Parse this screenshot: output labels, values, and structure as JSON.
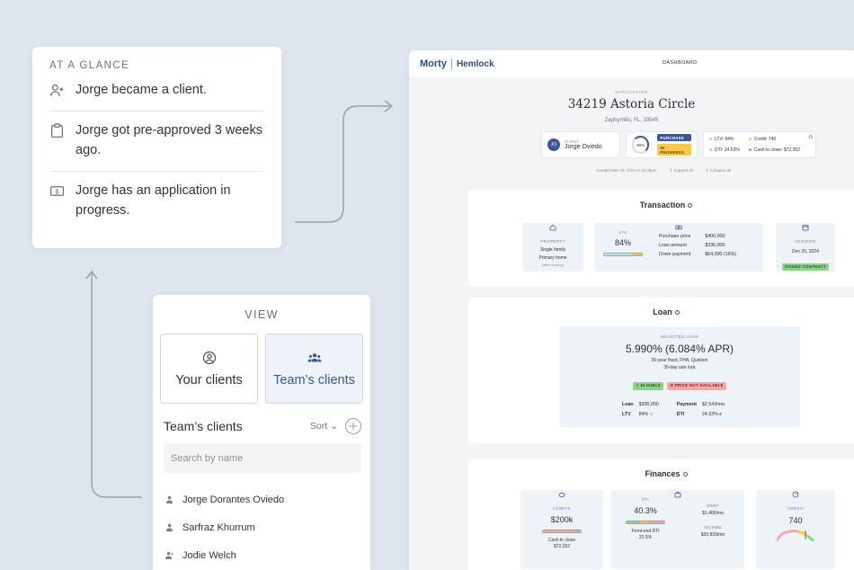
{
  "glance": {
    "heading": "AT A GLANCE",
    "items": [
      {
        "icon": "person-add-icon",
        "text": "Jorge became a client."
      },
      {
        "icon": "clipboard-icon",
        "text": "Jorge got pre-approved 3 weeks ago."
      },
      {
        "icon": "dollar-doc-icon",
        "text": "Jorge has an application in progress."
      }
    ]
  },
  "view": {
    "heading": "VIEW",
    "your_clients": "Your clients",
    "teams_clients": "Team’s clients",
    "list_title": "Team’s clients",
    "sort": "Sort",
    "search_placeholder": "Search by name",
    "clients": [
      "Jorge Dorantes Oviedo",
      "Sarfraz Khurrum",
      "Jodie Welch"
    ]
  },
  "dashboard": {
    "brand": "Morty",
    "partner": "Hemlock",
    "nav": "DASHBOARD",
    "application_label": "APPLICATION",
    "address": "34219 Astoria Circle",
    "city": "Zephyrhills, FL, 33545",
    "client_label": "CLIENT",
    "client_initials": "JO",
    "client_name": "Jorge Oviedo",
    "progress": "90%",
    "progress_value": 0.9,
    "badge_purchase": "PURCHASE",
    "badge_status": "IN PROGRESS",
    "ltv": "LTV: 84%",
    "credit": "Credit: 740",
    "dti": "DTI: 24.53%",
    "cash": "Cash to close: $72,352",
    "created": "Created Mar 18, 2024 at 12:39pm",
    "expand": "Expand all",
    "collapse": "Collapse all",
    "colors": {
      "brand": "#2c4b8a",
      "green": "#8fd08d",
      "yellow": "#f6c94a",
      "red": "#f8a7a7"
    }
  },
  "transaction": {
    "title": "Transaction",
    "property_label": "PROPERTY",
    "property_type": "Single family",
    "property_use": "Primary home",
    "property_note": "(after closing)",
    "ltv_label": "LTV",
    "ltv_value": "84%",
    "purchase_label": "Purchase price",
    "purchase_value": "$400,000",
    "loan_label": "Loan amount",
    "loan_value": "$336,000",
    "down_label": "Down payment",
    "down_value": "$64,000 (16%)",
    "closing_label": "CLOSING",
    "closing_date": "Dec 20, 2024",
    "closing_badge": "SIGNED CONTRACT"
  },
  "loan": {
    "title": "Loan",
    "selected_label": "SELECTED LOAN",
    "rate": "5.990% (6.084% APR)",
    "desc": "30-year fixed, FHA, Quicken",
    "lock": "30-day rate lock",
    "eligible": "✓ ELIGIBLE",
    "price": "⊘ PRICE NOT AVAILABLE",
    "loan_label": "Loan",
    "loan_value": "$336,000",
    "payment_label": "Payment",
    "payment_value": "$2,543/mo.",
    "ltv_label": "LTV",
    "ltv_value": "84%",
    "dti_label": "DTI",
    "dti_value": "24.53%"
  },
  "finances": {
    "title": "Finances",
    "assets_label": "ASSETS",
    "assets_value": "$200k",
    "cash_label": "Cash to close",
    "cash_value": "$72,352",
    "dti_label": "DTI",
    "dti_value": "40.3%",
    "frontend_label": "Front-end DTI",
    "frontend_value": "22.5%",
    "debt_label": "DEBT",
    "debt_value": "$1,400/mo",
    "income_label": "INCOME",
    "income_value": "$20,833/mo",
    "credit_label": "CREDIT",
    "credit_value": "740"
  }
}
